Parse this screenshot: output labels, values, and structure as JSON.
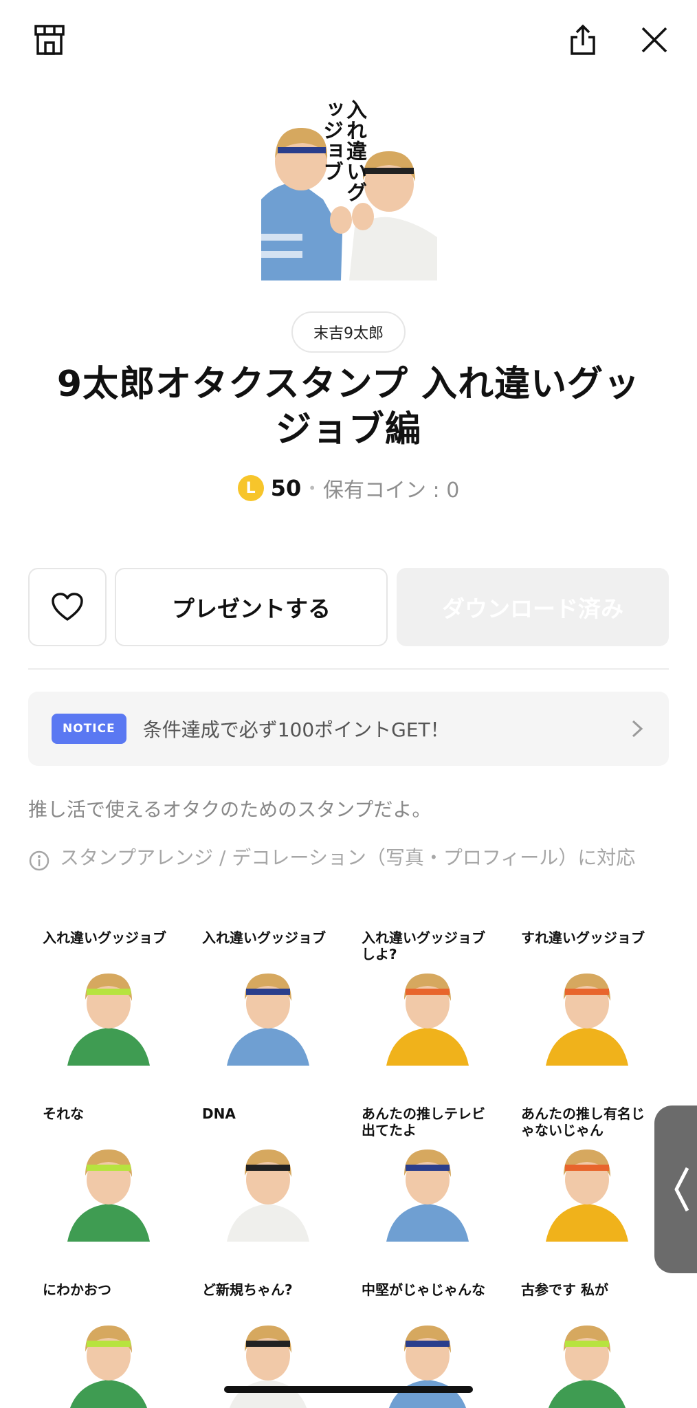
{
  "header": {
    "shop_icon": "shop-icon",
    "share_icon": "share-icon",
    "close_icon": "close-icon"
  },
  "main_image_text": "入れ違いグッジョブ",
  "author": "末吉9太郎",
  "title": "9太郎オタクスタンプ 入れ違いグッジョブ編",
  "price": {
    "coin_letter": "L",
    "amount": "50",
    "separator": "•",
    "owned": "保有コイン : 0"
  },
  "actions": {
    "like_icon": "heart-icon",
    "present_label": "プレゼントする",
    "download_label": "ダウンロード済み"
  },
  "notice": {
    "badge": "NOTICE",
    "text": "条件達成で必ず100ポイントGET！",
    "chevron_icon": "chevron-right-icon"
  },
  "description": "推し活で使えるオタクのためのスタンプだよ。",
  "feature": {
    "icon": "info-icon",
    "text": "スタンプアレンジ / デコレーション（写真・プロフィール）に対応"
  },
  "stickers": [
    {
      "text": "入れ違いグッジョブ"
    },
    {
      "text": "入れ違いグッジョブ"
    },
    {
      "text": "入れ違いグッジョブしよ?"
    },
    {
      "text": "すれ違いグッジョブ"
    },
    {
      "text": "それな"
    },
    {
      "text": "DNA"
    },
    {
      "text": "あんたの推しテレビ出てたよ"
    },
    {
      "text": "あんたの推し有名じゃないじゃん"
    },
    {
      "text": "にわかおつ"
    },
    {
      "text": "ど新規ちゃん?"
    },
    {
      "text": "中堅がじゃじゃんな"
    },
    {
      "text": "古参です 私が"
    }
  ],
  "colors": {
    "accent_notice": "#5a78f2",
    "coin": "#f7c52b",
    "headband": "#b7e33f"
  }
}
